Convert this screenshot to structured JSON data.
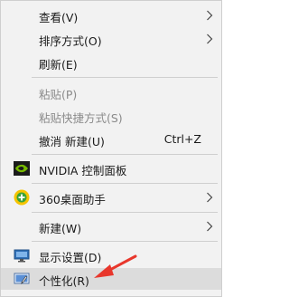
{
  "menu": {
    "items": [
      {
        "label": "查看(V)",
        "has_submenu": true
      },
      {
        "label": "排序方式(O)",
        "has_submenu": true
      },
      {
        "label": "刷新(E)"
      },
      {
        "label": "粘贴(P)",
        "disabled": true
      },
      {
        "label": "粘贴快捷方式(S)",
        "disabled": true
      },
      {
        "label": "撤消 新建(U)",
        "shortcut": "Ctrl+Z"
      },
      {
        "label": "NVIDIA 控制面板",
        "icon": "nvidia-icon"
      },
      {
        "label": "360桌面助手",
        "icon": "360-desktop-icon",
        "has_submenu": true
      },
      {
        "label": "新建(W)",
        "has_submenu": true
      },
      {
        "label": "显示设置(D)",
        "icon": "display-settings-icon"
      },
      {
        "label": "个性化(R)",
        "icon": "personalize-icon",
        "highlighted": true
      }
    ]
  },
  "colors": {
    "menu_background": "#f2f2f2",
    "highlight": "#dcdcdc",
    "disabled_text": "#8a8a8a",
    "annotation_arrow": "#e8372c",
    "nvidia_green": "#76b900",
    "brand_360_yellow": "#f5c400",
    "brand_360_green": "#3aa33a",
    "display_icon_blue": "#2f6fb7"
  }
}
